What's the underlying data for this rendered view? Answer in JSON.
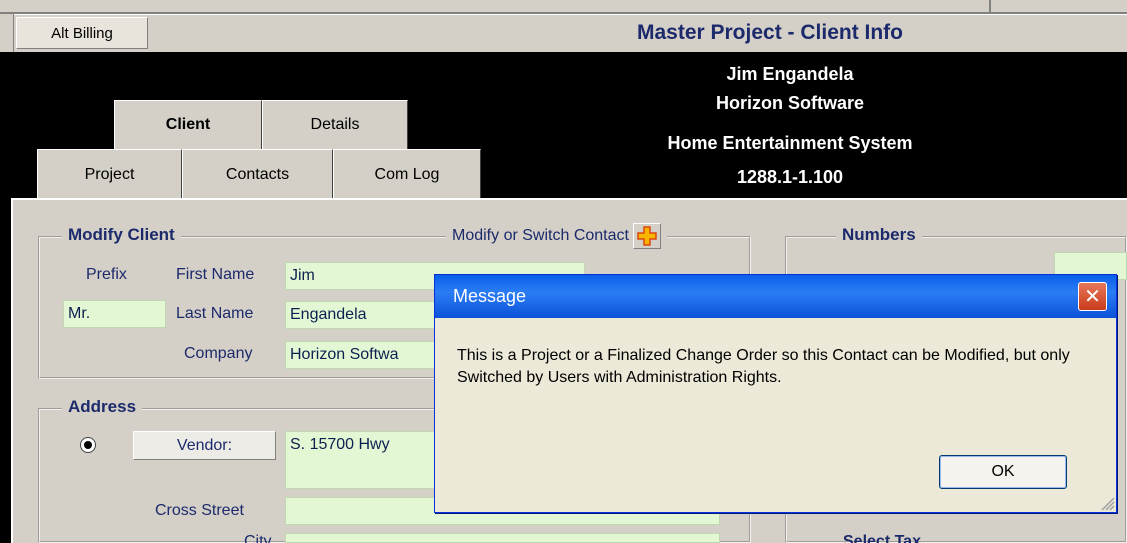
{
  "window": {
    "alt_billing": "Alt Billing",
    "title": "Master Project - Client Info"
  },
  "header": {
    "client_name": "Jim Engandela",
    "company": "Horizon Software",
    "project": "Home Entertainment System",
    "number": "1288.1-1.100"
  },
  "tabs": {
    "client": "Client",
    "details": "Details",
    "project": "Project",
    "contacts": "Contacts",
    "com_log": "Com Log"
  },
  "modify_client": {
    "title": "Modify Client",
    "modify_switch_label": "Modify or Switch Contact",
    "prefix_label": "Prefix",
    "prefix_value": "Mr.",
    "first_name_label": "First Name",
    "first_name_value": "Jim",
    "last_name_label": "Last Name",
    "last_name_value": "Engandela",
    "company_label": "Company",
    "company_value": "Horizon Softwa"
  },
  "numbers": {
    "title": "Numbers"
  },
  "address": {
    "title": "Address",
    "vendor_label": "Vendor:",
    "street_value": "S. 15700 Hwy",
    "cross_street_label": "Cross Street",
    "cross_street_value": "",
    "city_label": "City",
    "select_tax_label": "Select Tax"
  },
  "dialog": {
    "title": "Message",
    "message": "This is a Project or a Finalized Change Order so this Contact can be Modified, but only Switched by Users with Administration Rights.",
    "ok_label": "OK",
    "close_glyph": "✕"
  },
  "colors": {
    "label_navy": "#1c2a6b",
    "field_green": "#e4f7d4",
    "dialog_blue": "#0a5fea",
    "close_red": "#c93b1b"
  }
}
